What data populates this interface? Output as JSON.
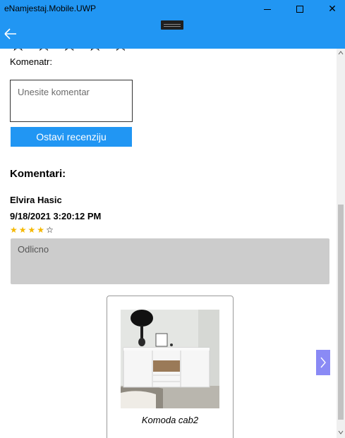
{
  "window": {
    "title": "eNamjestaj.Mobile.UWP",
    "close_glyph": "✕"
  },
  "navbar": {
    "back_icon": "back-arrow-icon",
    "color": "#2196f3"
  },
  "form": {
    "comment_label": "Komenatr:",
    "comment_placeholder": "Unesite komentar",
    "submit_label": "Ostavi recenziju"
  },
  "comments": {
    "heading": "Komentari:",
    "items": [
      {
        "author": "Elvira Hasic",
        "date": "9/18/2021 3:20:12 PM",
        "rating": 4,
        "max_rating": 5,
        "text": "Odlicno"
      }
    ]
  },
  "products": {
    "items": [
      {
        "name": "Komoda cab2"
      }
    ]
  },
  "colors": {
    "accent": "#2196f3",
    "star_filled": "#f5b800",
    "review_background": "#cccccc",
    "next_arrow": "#8a8af5"
  }
}
